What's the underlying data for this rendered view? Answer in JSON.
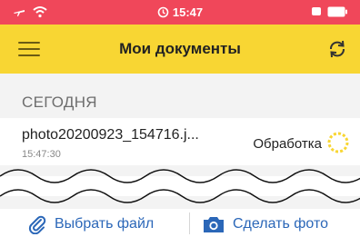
{
  "status_bar": {
    "time": "15:47",
    "background": "#f0475a"
  },
  "header": {
    "title": "Мои документы",
    "background": "#f8d633",
    "menu_icon": "hamburger-menu-icon",
    "sync_icon": "sync-icon"
  },
  "section": {
    "title": "СЕГОДНЯ"
  },
  "documents": [
    {
      "name": "photo20200923_154716.j...",
      "time": "15:47:30",
      "status": "Обработка",
      "status_icon": "loading-spinner-icon"
    }
  ],
  "toolbar": {
    "pick_file_label": "Выбрать файл",
    "pick_file_icon": "paperclip-icon",
    "take_photo_label": "Сделать фото",
    "take_photo_icon": "camera-icon",
    "accent": "#2b67b8"
  }
}
